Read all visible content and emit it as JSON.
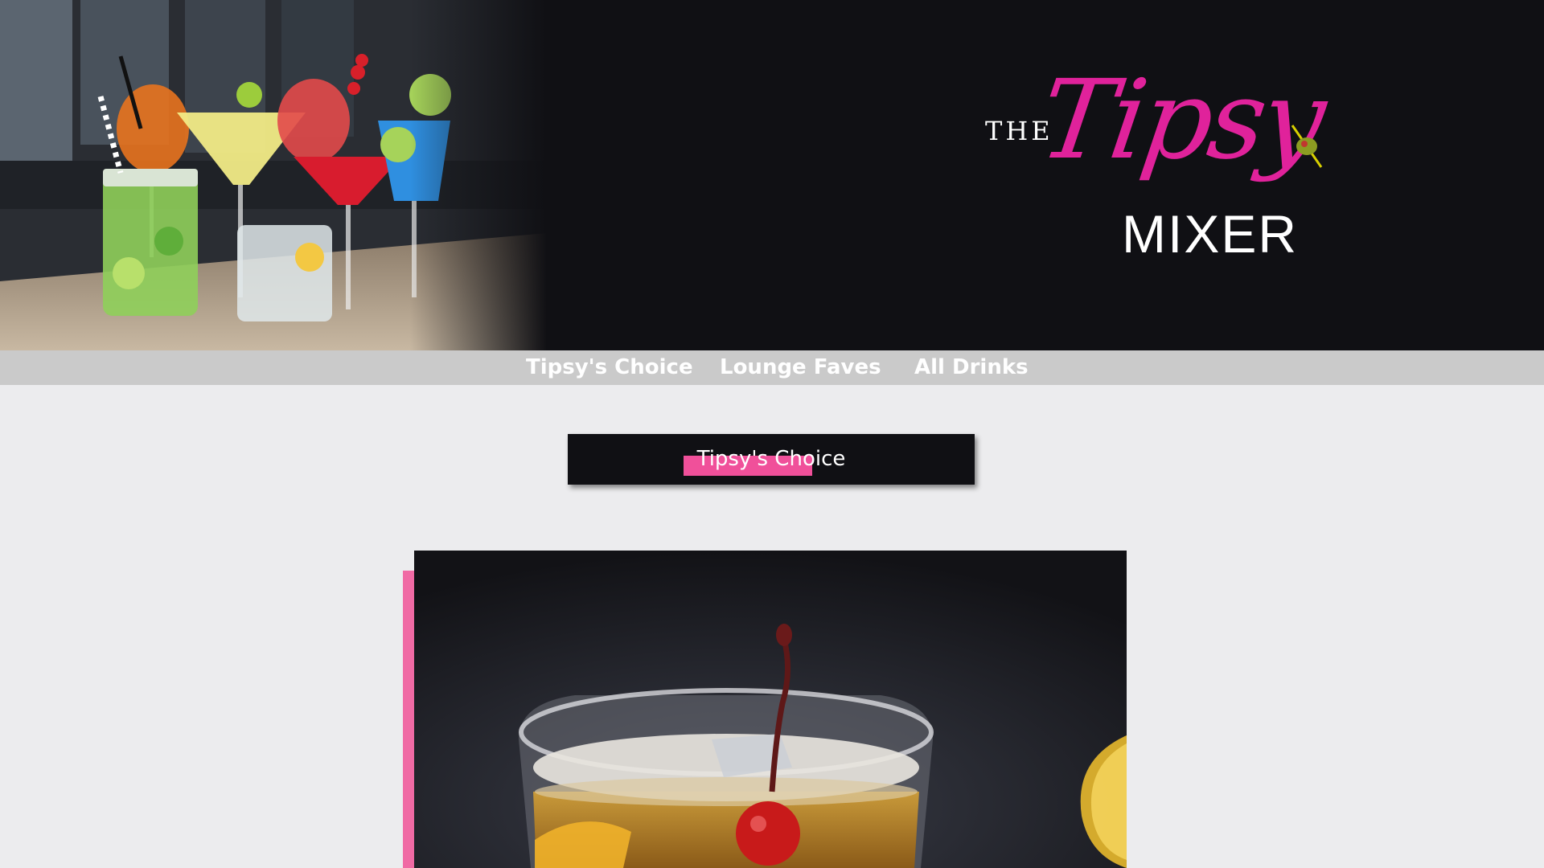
{
  "header": {
    "logo": {
      "the": "THE",
      "tipsy": "Tipsy",
      "mixer": "MIXER"
    },
    "hero_image": "cocktail-glasses-photo"
  },
  "nav": {
    "items": [
      {
        "label": "Tipsy's Choice"
      },
      {
        "label": "Lounge Faves"
      },
      {
        "label": "All Drinks"
      }
    ]
  },
  "section": {
    "title": "Tipsy's Choice"
  },
  "featured": {
    "image": "whiskey-sour-cocktail-photo"
  },
  "colors": {
    "header_bg": "#101014",
    "brand_pink": "#e0229b",
    "highlight_pink": "#f0509a",
    "nav_bg": "#cacaca",
    "page_bg": "#ececee"
  }
}
